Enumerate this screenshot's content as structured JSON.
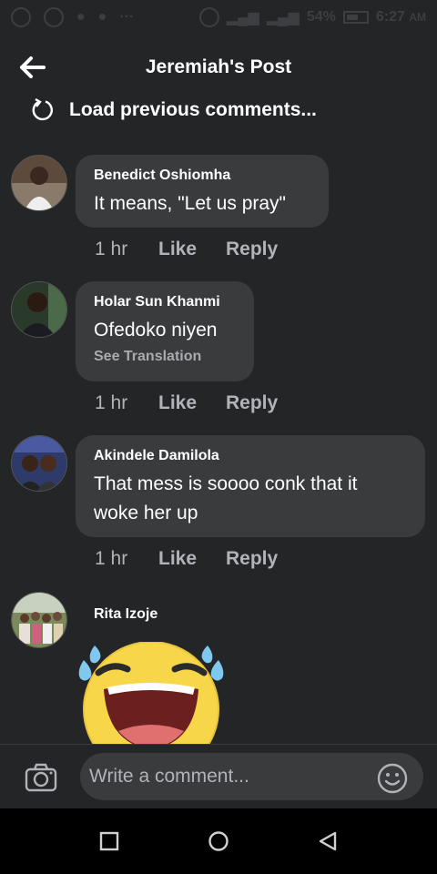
{
  "status_bar": {
    "battery": "54%",
    "time": "6:27",
    "ampm": "AM"
  },
  "header": {
    "title": "Jeremiah's Post"
  },
  "load_previous": {
    "label": "Load previous comments..."
  },
  "comments": [
    {
      "author": "Benedict Oshiomha",
      "text": "It means, \"Let us pray\"",
      "time": "1 hr",
      "like": "Like",
      "reply": "Reply"
    },
    {
      "author": "Holar Sun Khanmi",
      "text": "Ofedoko niyen",
      "see_translation": "See Translation",
      "time": "1 hr",
      "like": "Like",
      "reply": "Reply"
    },
    {
      "author": "Akindele Damilola",
      "text": "That  mess is soooo conk that it woke her up",
      "time": "1 hr",
      "like": "Like",
      "reply": "Reply"
    },
    {
      "author": "Rita Izoje",
      "sticker": "laughing-tears-emoji"
    }
  ],
  "composer": {
    "placeholder": "Write a comment..."
  },
  "colors": {
    "background": "#242527",
    "bubble": "#3a3b3d",
    "muted_text": "#b0b3b8",
    "sticker_yellow": "#f7d64a"
  }
}
